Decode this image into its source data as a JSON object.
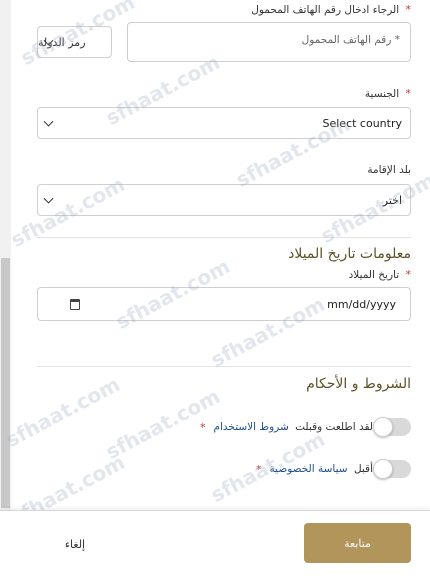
{
  "phone": {
    "label": "الرجاء ادخال رقم الهاتف المحمول",
    "required_mark": "*",
    "placeholder": "* رقم الهاتف المحمول",
    "country_code_label": "رمز الدولة"
  },
  "nationality": {
    "label": "الجنسية",
    "required_mark": "*",
    "selected": "Select country"
  },
  "residence": {
    "label": "بلد الإقامة",
    "selected": "اختر"
  },
  "birth": {
    "section_title": "معلومات تاريخ الميلاد",
    "label": "تاريخ الميلاد",
    "required_mark": "*",
    "date_value": "mm/dd/yyyy"
  },
  "terms": {
    "section_title": "الشروط و الأحكام",
    "terms_prefix": "لقد اطلعت وقبلت",
    "terms_link": "شروط الاستخدام",
    "terms_required": "*",
    "privacy_prefix": "أقبل",
    "privacy_link": "سياسة الخصوصية",
    "privacy_required": "*"
  },
  "footer": {
    "continue_label": "متابعة",
    "cancel_label": "إلغاء"
  },
  "watermark": "sfhaat.com",
  "colors": {
    "accent": "#b1955a",
    "section_title": "#5d5127",
    "required": "#c0392b",
    "link": "#1f4f8a"
  }
}
